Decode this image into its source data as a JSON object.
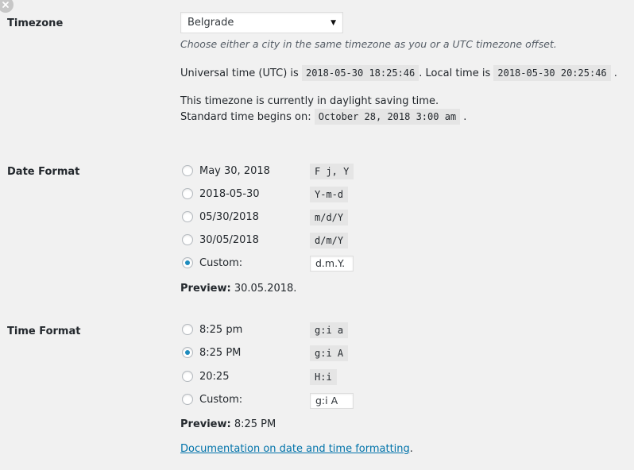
{
  "timezone": {
    "label": "Timezone",
    "selected": "Belgrade",
    "caret": "▼",
    "description": "Choose either a city in the same timezone as you or a UTC timezone offset.",
    "utc_prefix": "Universal time (UTC) is",
    "utc_time": "2018-05-30 18:25:46",
    "local_prefix": ". Local time is",
    "local_time": "2018-05-30 20:25:46",
    "local_suffix": ".",
    "dst_note": "This timezone is currently in daylight saving time.",
    "standard_prefix": "Standard time begins on:",
    "standard_time": "October 28, 2018 3:00 am",
    "standard_suffix": "."
  },
  "date_format": {
    "label": "Date Format",
    "options": [
      {
        "label": "May 30, 2018",
        "code": "F j, Y",
        "checked": false
      },
      {
        "label": "2018-05-30",
        "code": "Y-m-d",
        "checked": false
      },
      {
        "label": "05/30/2018",
        "code": "m/d/Y",
        "checked": false
      },
      {
        "label": "30/05/2018",
        "code": "d/m/Y",
        "checked": false
      },
      {
        "label": "Custom:",
        "custom_value": "d.m.Y.",
        "checked": true
      }
    ],
    "preview_label": "Preview:",
    "preview_value": "30.05.2018."
  },
  "time_format": {
    "label": "Time Format",
    "options": [
      {
        "label": "8:25 pm",
        "code": "g:i a",
        "checked": false
      },
      {
        "label": "8:25 PM",
        "code": "g:i A",
        "checked": true
      },
      {
        "label": "20:25",
        "code": "H:i",
        "checked": false
      },
      {
        "label": "Custom:",
        "custom_value": "g:i A",
        "checked": false
      }
    ],
    "preview_label": "Preview:",
    "preview_value": "8:25 PM"
  },
  "documentation": {
    "link_text": "Documentation on date and time formatting",
    "suffix": "."
  },
  "colors": {
    "background": "#f1f1f1",
    "link": "#0073aa",
    "radio_checked": "#1e8cbe",
    "code_bg": "#e5e5e5"
  }
}
